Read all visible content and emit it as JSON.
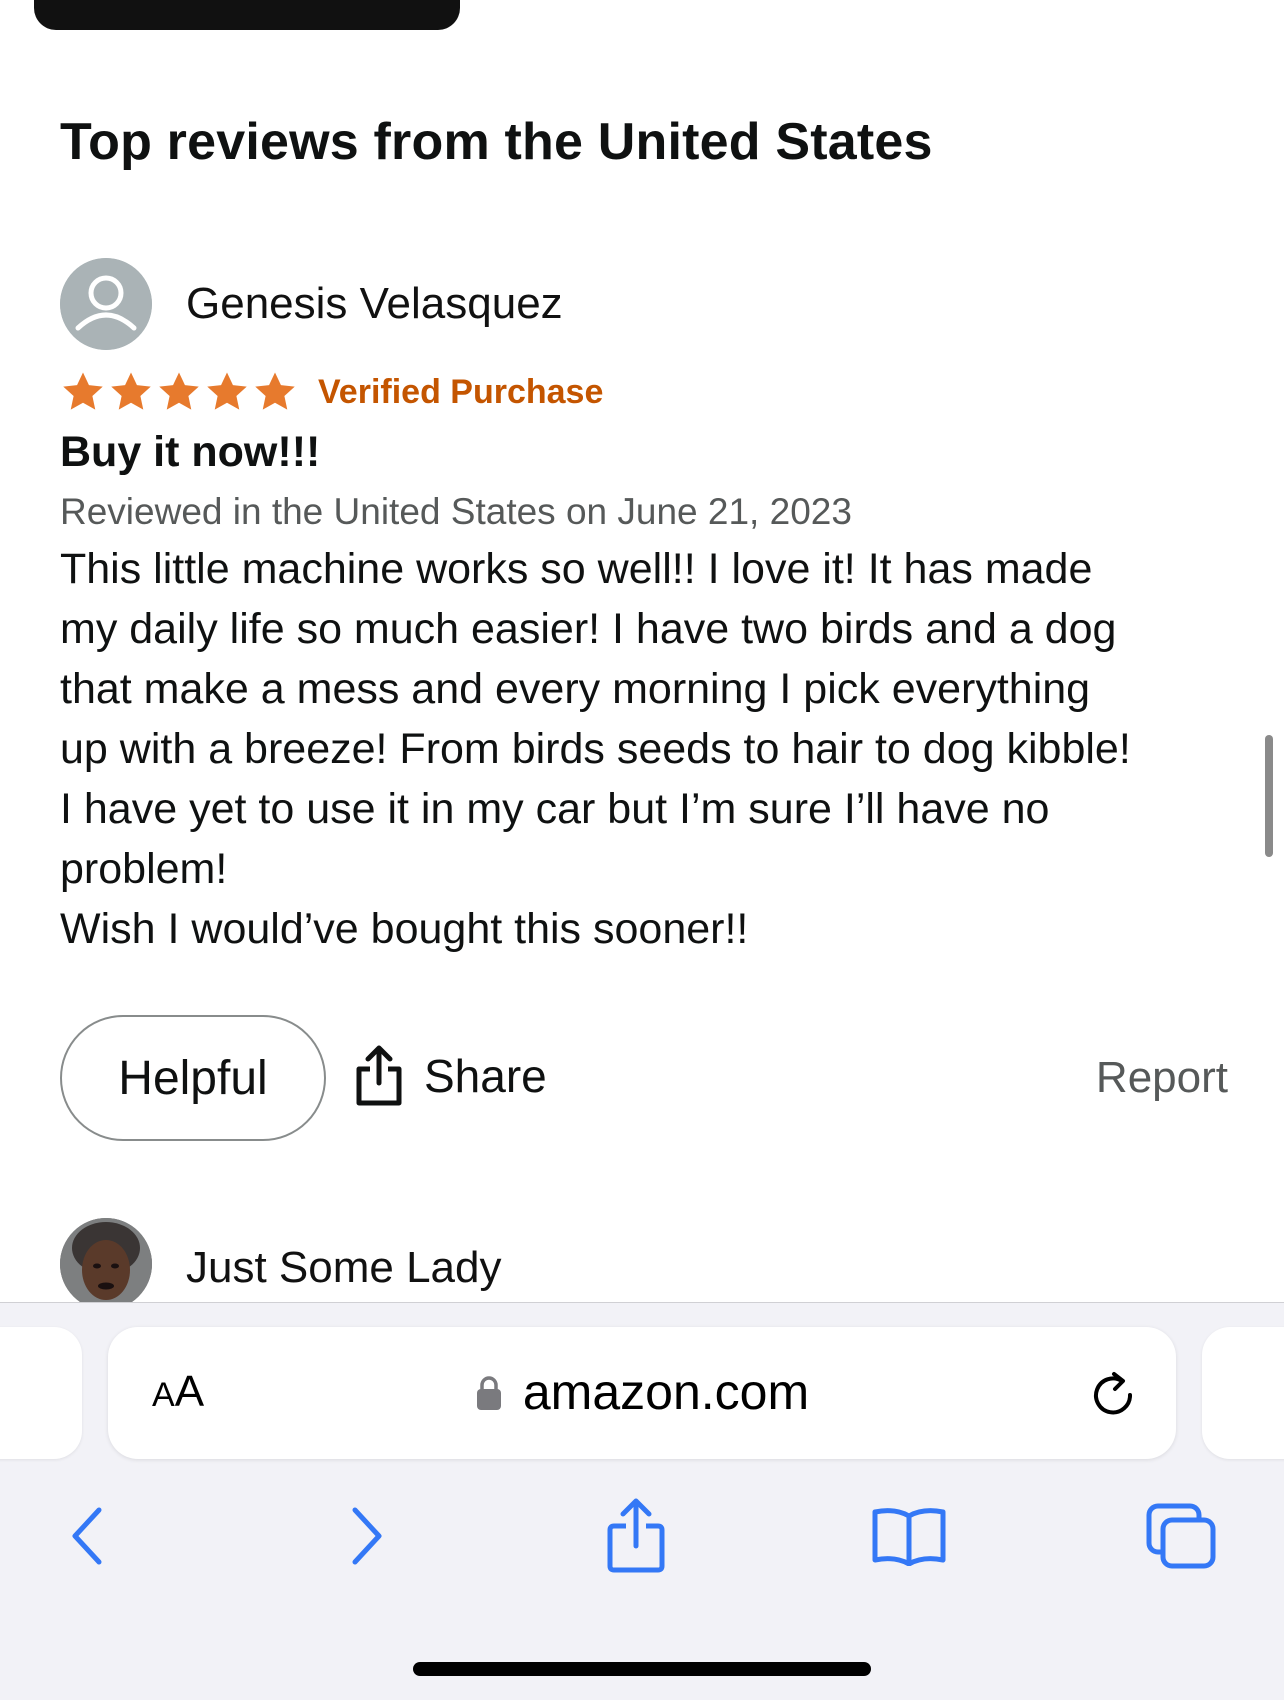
{
  "section": {
    "title": "Top reviews from the United States"
  },
  "reviews": [
    {
      "reviewer": "Genesis Velasquez",
      "rating": 5,
      "verified_label": "Verified Purchase",
      "title": "Buy it now!!!",
      "date_line": "Reviewed in the United States on June 21, 2023",
      "body_lines": [
        "This little machine works so well!! I love it! It has made",
        "my daily life so much easier! I have two birds and a dog",
        "that make a mess and every morning I pick everything",
        "up with a breeze! From birds seeds to hair to dog kibble!",
        "I have yet to use it in my car but I’m sure I’ll have no",
        "problem!",
        "Wish I would’ve bought this sooner!!"
      ]
    },
    {
      "reviewer": "Just Some Lady"
    }
  ],
  "actions": {
    "helpful_label": "Helpful",
    "share_label": "Share",
    "report_label": "Report"
  },
  "browser": {
    "aa_small": "A",
    "aa_large": "A",
    "url": "amazon.com"
  },
  "colors": {
    "star": "#e77a2d",
    "verified": "#c45500",
    "safari_blue": "#3478f6"
  },
  "icons": {
    "avatar": "default-user-icon",
    "share": "share-icon",
    "lock": "lock-icon",
    "reload": "reload-icon",
    "back": "chevron-left-icon",
    "forward": "chevron-right-icon",
    "safari_share": "share-icon",
    "bookmarks": "book-icon",
    "tabs": "tabs-icon"
  }
}
